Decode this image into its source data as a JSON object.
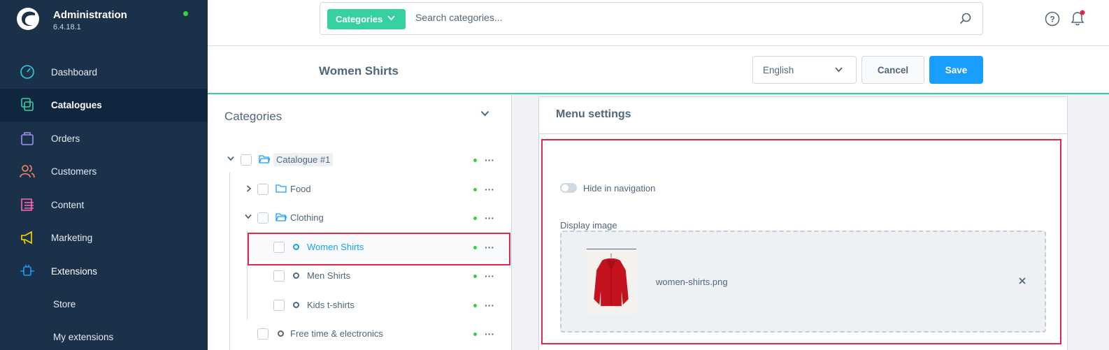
{
  "brand": {
    "title": "Administration",
    "version": "6.4.18.1"
  },
  "sidebar": {
    "items": [
      {
        "label": "Dashboard",
        "icon": "dashboard-icon",
        "color": "#2ecfe0"
      },
      {
        "label": "Catalogues",
        "icon": "catalogues-icon",
        "color": "#37d1a1"
      },
      {
        "label": "Orders",
        "icon": "orders-icon",
        "color": "#a092f0"
      },
      {
        "label": "Customers",
        "icon": "customers-icon",
        "color": "#f88962"
      },
      {
        "label": "Content",
        "icon": "content-icon",
        "color": "#ff68b4"
      },
      {
        "label": "Marketing",
        "icon": "marketing-icon",
        "color": "#ffd700"
      },
      {
        "label": "Extensions",
        "icon": "extensions-icon",
        "color": "#189eff"
      }
    ],
    "sub_items": [
      {
        "label": "Store"
      },
      {
        "label": "My extensions"
      }
    ]
  },
  "search": {
    "type_label": "Categories",
    "placeholder": "Search categories..."
  },
  "header": {
    "title": "Women Shirts",
    "language": "English",
    "cancel_label": "Cancel",
    "save_label": "Save"
  },
  "tree": {
    "title": "Categories",
    "nodes": [
      {
        "name": "Catalogue #1"
      },
      {
        "name": "Food"
      },
      {
        "name": "Clothing"
      },
      {
        "name": "Women Shirts"
      },
      {
        "name": "Men Shirts"
      },
      {
        "name": "Kids t-shirts"
      },
      {
        "name": "Free time & electronics"
      }
    ]
  },
  "menu_settings": {
    "title": "Menu settings",
    "hide_in_navigation_label": "Hide in navigation",
    "display_image_label": "Display image",
    "image_filename": "women-shirts.png"
  },
  "colors": {
    "accent": "#37d1a1",
    "primary": "#189eff",
    "sidebar_bg": "#1b3049",
    "highlight": "#de294c"
  }
}
